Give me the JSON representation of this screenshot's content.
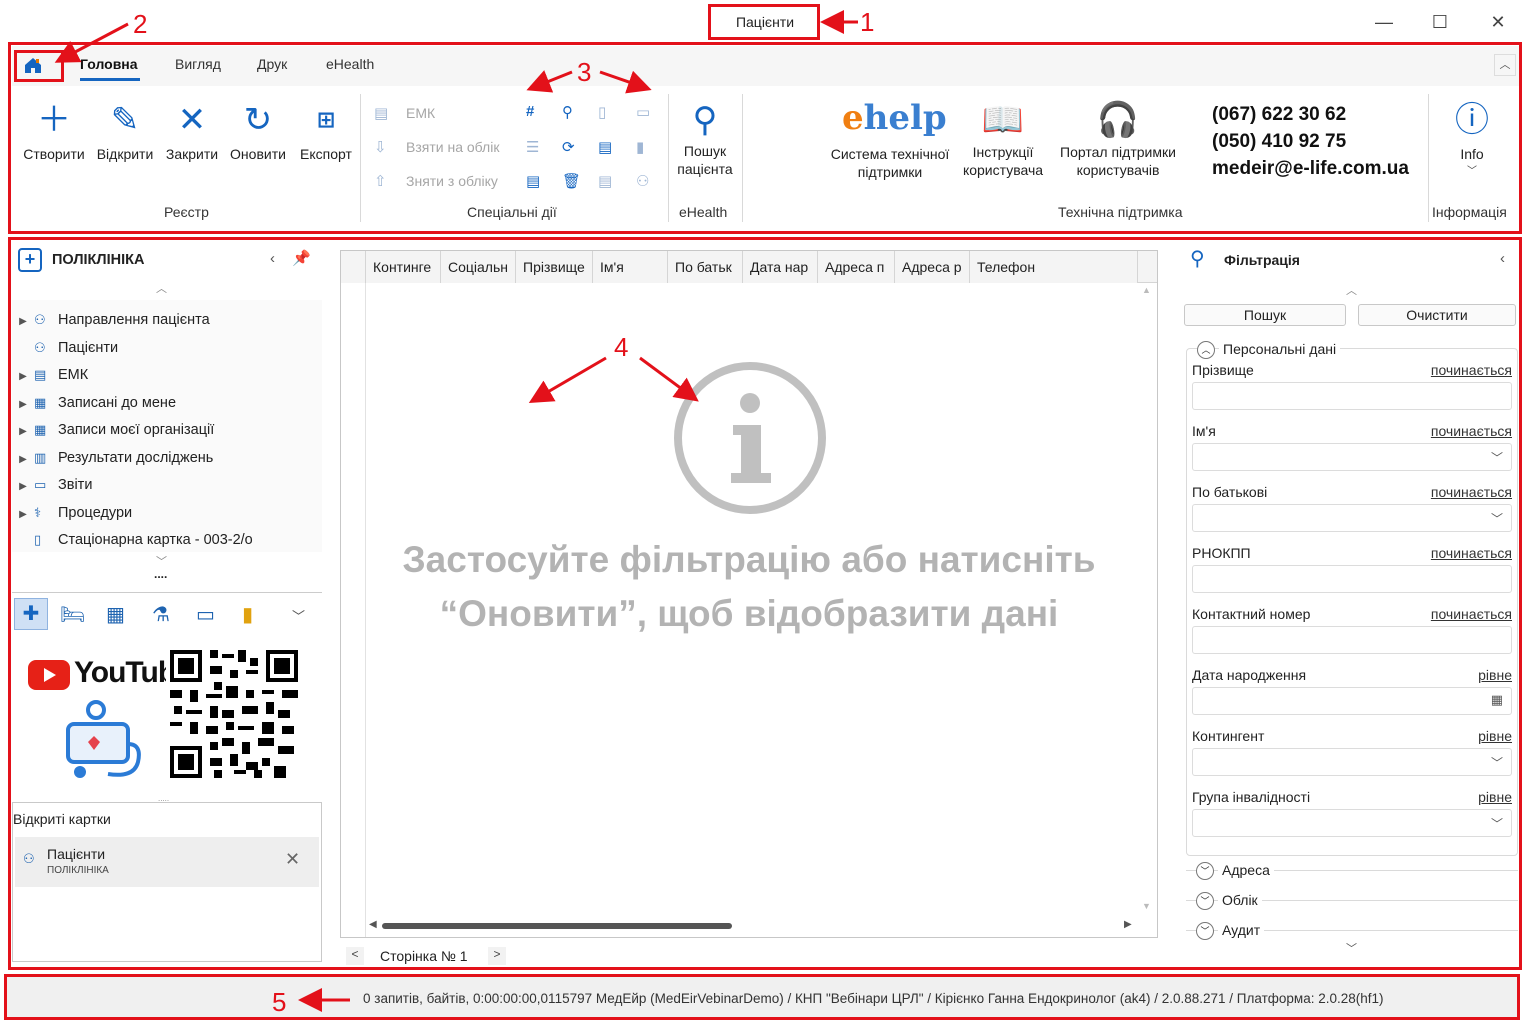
{
  "window": {
    "title": "Пацієнти"
  },
  "annotations": [
    "1",
    "2",
    "3",
    "3",
    "4",
    "5"
  ],
  "ribbon_tabs": [
    "Головна",
    "Вигляд",
    "Друк",
    "eHealth"
  ],
  "registry_group": {
    "label": "Реєстр",
    "buttons": [
      "Створити",
      "Відкрити",
      "Закрити",
      "Оновити",
      "Експорт"
    ]
  },
  "special_group": {
    "label": "Спеціальні дії",
    "items": [
      "ЕМК",
      "Взяти на облік",
      "Зняти з обліку"
    ]
  },
  "ehealth_group": {
    "label": "eHealth",
    "search_line1": "Пошук",
    "search_line2": "пацієнта"
  },
  "support_group": {
    "label": "Технічна підтримка",
    "logo": "help",
    "system_line1": "Система технічної",
    "system_line2": "підтримки",
    "instr_line1": "Інструкції",
    "instr_line2": "користувача",
    "portal_line1": "Портал підтримки",
    "portal_line2": "користувачів",
    "phone1": "(067) 622 30 62",
    "phone2": "(050) 410 92 75",
    "email": "medeir@e-life.com.ua"
  },
  "info_group": {
    "label": "Інформація",
    "button": "Info"
  },
  "sidebar": {
    "title": "ПОЛІКЛІНІКА",
    "items": [
      "Направлення пацієнта",
      "Пацієнти",
      "ЕМК",
      "Записані до мене",
      "Записи моєї організації",
      "Результати досліджень",
      "Звіти",
      "Процедури",
      "Стаціонарна картка - 003-2/о"
    ],
    "dots": "....",
    "youtube": "YouTube",
    "open_cards_label": "Відкриті картки",
    "open_card": {
      "title": "Пацієнти",
      "subtitle": "ПОЛІКЛІНІКА"
    }
  },
  "grid": {
    "columns": [
      "Континге",
      "Соціальн",
      "Прізвище",
      "Ім'я",
      "По батьк",
      "Дата нар",
      "Адреса п",
      "Адреса р",
      "Телефон"
    ],
    "empty_line1": "Застосуйте фільтрацію або натисніть",
    "empty_line2": "“Оновити”, щоб відобразити дані",
    "pager": "Сторінка № 1",
    "pager_prev": "<",
    "pager_next": ">"
  },
  "filter": {
    "title": "Фільтрація",
    "search_btn": "Пошук",
    "clear_btn": "Очистити",
    "section": "Персональні дані",
    "fields": [
      {
        "label": "Прізвище",
        "op": "починається"
      },
      {
        "label": "Ім'я",
        "op": "починається"
      },
      {
        "label": "По батькові",
        "op": "починається"
      },
      {
        "label": "РНОКПП",
        "op": "починається"
      },
      {
        "label": "Контактний номер",
        "op": "починається"
      },
      {
        "label": "Дата народження",
        "op": "рівне"
      },
      {
        "label": "Контингент",
        "op": "рівне"
      },
      {
        "label": "Група інвалідності",
        "op": "рівне"
      }
    ],
    "collapsed_sections": [
      "Адреса",
      "Облік",
      "Аудит"
    ]
  },
  "status": {
    "text": "0 запитів,  байтів, 0:00:00:00,0115797  МедЕйр (MedEirVebinarDemo) / КНП \"Вебінари ЦРЛ\" / Кірієнко Ганна Ендокринолог (ak4) / 2.0.88.271 / Платформа: 2.0.28(hf1)"
  },
  "colors": {
    "accent": "#1565c0",
    "annotation": "#e3111a"
  }
}
